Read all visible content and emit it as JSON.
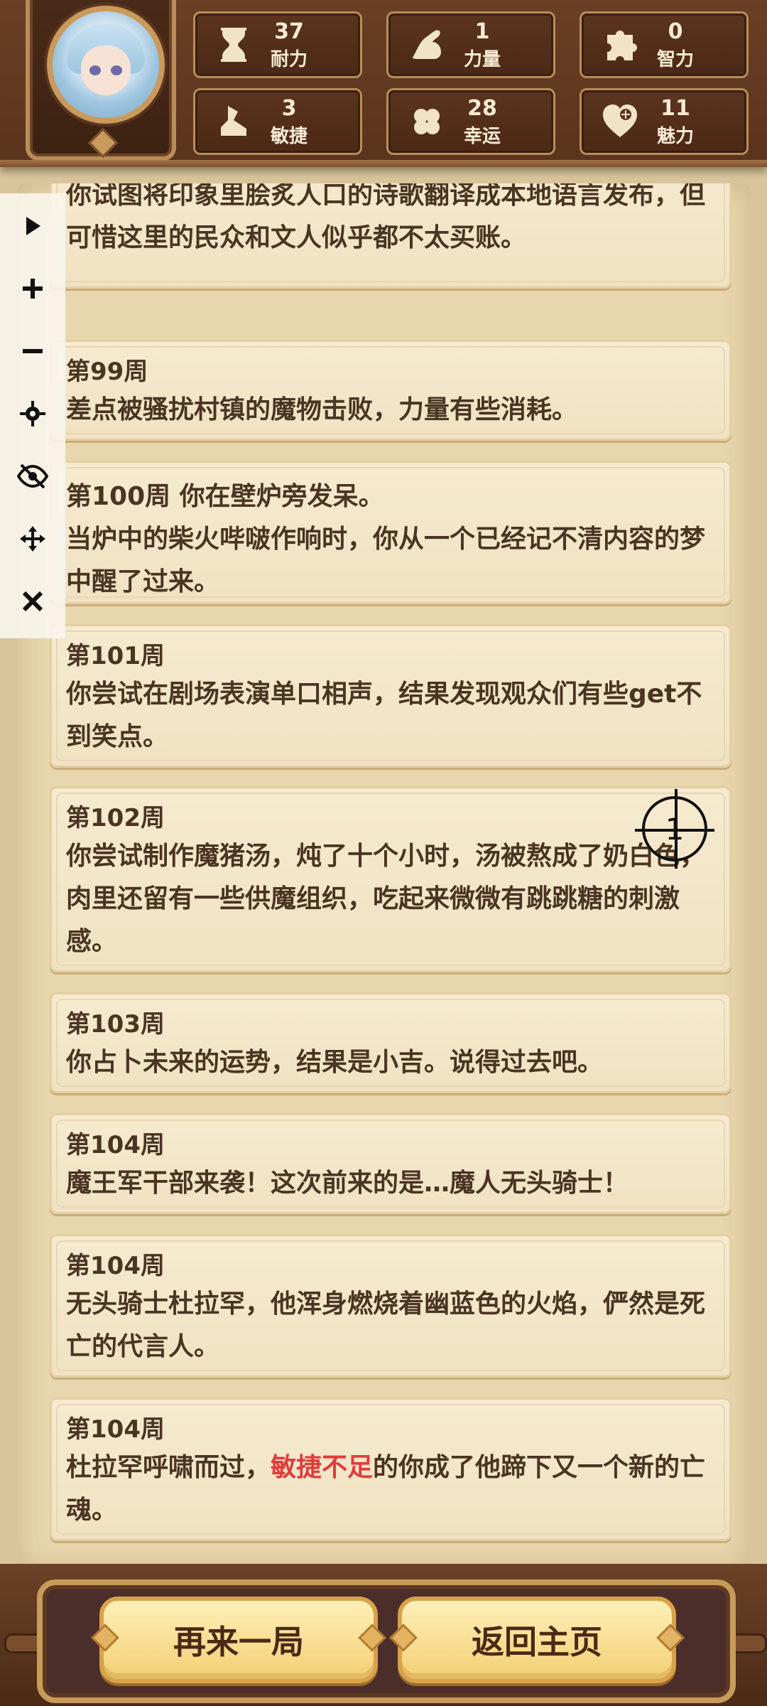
{
  "stats": [
    {
      "value": "37",
      "label": "耐力",
      "icon": "hourglass-icon"
    },
    {
      "value": "1",
      "label": "力量",
      "icon": "muscle-arm-icon"
    },
    {
      "value": "0",
      "label": "智力",
      "icon": "puzzle-icon"
    },
    {
      "value": "3",
      "label": "敏捷",
      "icon": "boot-icon"
    },
    {
      "value": "28",
      "label": "幸运",
      "icon": "clover-icon"
    },
    {
      "value": "11",
      "label": "魅力",
      "icon": "heart-plus-icon"
    }
  ],
  "events": [
    {
      "week": "",
      "text": "你试图将印象里脍炙人口的诗歌翻译成本地语言发布，但可惜这里的民众和文人似乎都不太买账。"
    },
    {
      "week": "第99周",
      "text": "差点被骚扰村镇的魔物击败，力量有些消耗。"
    },
    {
      "week": "第100周 你在壁炉旁发呆。",
      "text": "当炉中的柴火哔啵作响时，你从一个已经记不清内容的梦中醒了过来。"
    },
    {
      "week": "第101周",
      "text": "你尝试在剧场表演单口相声，结果发现观众们有些get不到笑点。"
    },
    {
      "week": "第102周",
      "text": "你尝试制作魔猪汤，炖了十个小时，汤被熬成了奶白色，肉里还留有一些供魔组织，吃起来微微有跳跳糖的刺激感。"
    },
    {
      "week": "第103周",
      "text": "你占卜未来的运势，结果是小吉。说得过去吧。"
    },
    {
      "week": "第104周",
      "text": "魔王军干部来袭！这次前来的是…魔人无头骑士！"
    },
    {
      "week": "第104周",
      "text": "无头骑士杜拉罕，他浑身燃烧着幽蓝色的火焰，俨然是死亡的代言人。"
    },
    {
      "week": "第104周",
      "text_before": "杜拉罕呼啸而过，",
      "text_highlight": "敏捷不足",
      "text_after": "的你成了他蹄下又一个新的亡魂。"
    }
  ],
  "buttons": {
    "replay": "再来一局",
    "home": "返回主页"
  },
  "overlay": {
    "target_label": "1"
  },
  "colors": {
    "highlight": "#e33b3b",
    "accent": "#b98d58"
  }
}
